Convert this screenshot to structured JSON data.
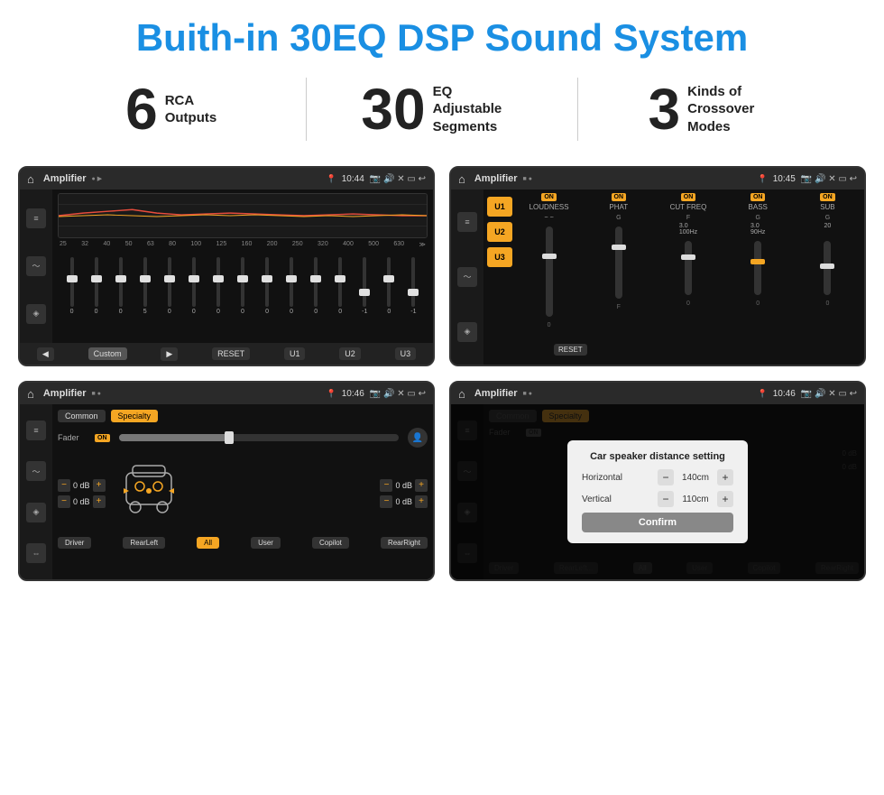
{
  "header": {
    "title": "Buith-in 30EQ DSP Sound System"
  },
  "stats": [
    {
      "number": "6",
      "label": "RCA\nOutputs"
    },
    {
      "number": "30",
      "label": "EQ Adjustable\nSegments"
    },
    {
      "number": "3",
      "label": "Kinds of\nCrossover Modes"
    }
  ],
  "screens": [
    {
      "id": "eq-screen",
      "topbar": {
        "title": "Amplifier",
        "time": "10:44"
      },
      "type": "eq"
    },
    {
      "id": "dsp-screen",
      "topbar": {
        "title": "Amplifier",
        "time": "10:45"
      },
      "type": "dsp"
    },
    {
      "id": "crossover-screen",
      "topbar": {
        "title": "Amplifier",
        "time": "10:46"
      },
      "type": "crossover"
    },
    {
      "id": "dialog-screen",
      "topbar": {
        "title": "Amplifier",
        "time": "10:46"
      },
      "type": "dialog"
    }
  ],
  "eq": {
    "frequencies": [
      "25",
      "32",
      "40",
      "50",
      "63",
      "80",
      "100",
      "125",
      "160",
      "200",
      "250",
      "320",
      "400",
      "500",
      "630"
    ],
    "values": [
      "0",
      "0",
      "0",
      "5",
      "0",
      "0",
      "0",
      "0",
      "0",
      "0",
      "0",
      "0",
      "-1",
      "0",
      "-1"
    ],
    "bottomButtons": [
      "◀",
      "Custom",
      "▶",
      "RESET",
      "U1",
      "U2",
      "U3"
    ]
  },
  "dsp": {
    "presets": [
      "U1",
      "U2",
      "U3"
    ],
    "channels": [
      {
        "label": "LOUDNESS",
        "on": true
      },
      {
        "label": "PHAT",
        "on": true
      },
      {
        "label": "CUT FREQ",
        "on": true
      },
      {
        "label": "BASS",
        "on": true
      },
      {
        "label": "SUB",
        "on": true
      }
    ],
    "resetBtn": "RESET"
  },
  "crossover": {
    "tabs": [
      "Common",
      "Specialty"
    ],
    "faderLabel": "Fader",
    "onLabel": "ON",
    "channels": [
      {
        "label": "0 dB"
      },
      {
        "label": "0 dB"
      },
      {
        "label": "0 dB"
      },
      {
        "label": "0 dB"
      }
    ],
    "buttons": [
      "Driver",
      "RearLeft",
      "All",
      "User",
      "Copilot",
      "RearRight"
    ]
  },
  "dialog": {
    "title": "Car speaker distance setting",
    "rows": [
      {
        "label": "Horizontal",
        "value": "140cm"
      },
      {
        "label": "Vertical",
        "value": "110cm"
      }
    ],
    "confirmBtn": "Confirm",
    "rightChannel1": "0 dB",
    "rightChannel2": "0 dB"
  }
}
